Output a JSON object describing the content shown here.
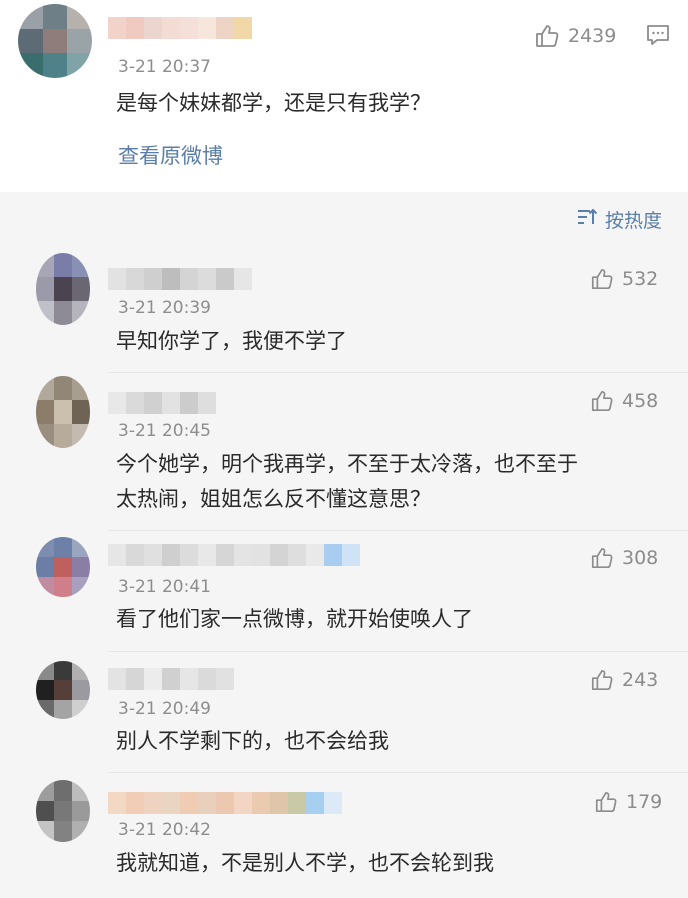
{
  "main_comment": {
    "avatar_colors": [
      "#9aa0a8",
      "#6f7f88",
      "#b7b1ad",
      "#5d6b76",
      "#8e7d7a",
      "#9aa3a8",
      "#3a6d6e",
      "#4e8288",
      "#7fa3a6"
    ],
    "name_colors": [
      "#f2d3c9",
      "#f0c9c0",
      "#ead6cf",
      "#f3dcd3",
      "#f4e0d8",
      "#f6e6dc",
      "#eed4c5",
      "#f0d8a8"
    ],
    "time": "3-21 20:37",
    "text": "是每个妹妹都学，还是只有我学？",
    "likes": "2439",
    "view_original": "查看原微博"
  },
  "sort": {
    "label": "按热度"
  },
  "replies": [
    {
      "avatar_colors": [
        "#a6a6b6",
        "#7a7da8",
        "#8890b4",
        "#9b9aa8",
        "#4b4350",
        "#6b6772",
        "#c0c0c8",
        "#8e8a96",
        "#b5b3bc"
      ],
      "name_colors": [
        "#e2e2e2",
        "#d8d8d8",
        "#cfcfcf",
        "#bdbdbd",
        "#d4d4d4",
        "#dcdcdc",
        "#cacaca",
        "#e6e6e6"
      ],
      "time": "3-21 20:39",
      "text": "早知你学了，我便不学了",
      "likes": "532"
    },
    {
      "avatar_colors": [
        "#b2a89c",
        "#928676",
        "#a89e90",
        "#8c7c6a",
        "#cbbfae",
        "#6e6354",
        "#9a8e80",
        "#b7ab9c",
        "#c4bbb0"
      ],
      "name_colors": [
        "#e8e8e8",
        "#dadada",
        "#d0d0d0",
        "#e2e2e2",
        "#cccccc",
        "#dedede"
      ],
      "time": "3-21 20:45",
      "text": [
        "今个她学，明个我再学，不至于太冷落，也不至于",
        "太热闹，姐姐怎么反不懂这意思？"
      ],
      "likes": "458"
    },
    {
      "avatar_colors": [
        "#7c8db0",
        "#6d80a8",
        "#9aa5c0",
        "#6d7ea6",
        "#c0605e",
        "#8a7ea4",
        "#c28ca0",
        "#d07e8a",
        "#a9a0c0"
      ],
      "name_colors": [
        "#e6e6e6",
        "#d9d9d9",
        "#e0e0e0",
        "#cfcfcf",
        "#dcdcdc",
        "#e8e8e8",
        "#d6d6d6",
        "#e4e4e4",
        "#e2e2e2",
        "#d4d4d4",
        "#dedede",
        "#e9e9e9",
        "#a9cdf0",
        "#cfe3f7"
      ],
      "time": "3-21 20:41",
      "text": "看了他们家一点微博，就开始使唤人了",
      "likes": "308"
    },
    {
      "avatar_colors": [
        "#8a8a8a",
        "#3a3a3a",
        "#b0b0b0",
        "#202020",
        "#553f38",
        "#9a9aa0",
        "#6a6a6a",
        "#a4a4a4",
        "#cfcfcf"
      ],
      "name_colors": [
        "#e3e3e3",
        "#d6d6d6",
        "#ececec",
        "#d0d0d0",
        "#e6e6e6",
        "#dadada",
        "#e1e1e1"
      ],
      "time": "3-21 20:49",
      "text": "别人不学剩下的，也不会给我",
      "likes": "243"
    },
    {
      "avatar_colors": [
        "#9d9d9d",
        "#6e6e6e",
        "#bcbcbc",
        "#4f4f4f",
        "#787878",
        "#9a9a9a",
        "#c4c4c4",
        "#828282",
        "#b0b0b0"
      ],
      "name_colors": [
        "#f3d9c4",
        "#f1cdb8",
        "#efd3c0",
        "#ead5c2",
        "#f0ccb2",
        "#e9d0bd",
        "#ecc8b0",
        "#f2d6c3",
        "#eacbb0",
        "#dfc6ab",
        "#c9c9a8",
        "#a7cff0",
        "#dce9f6"
      ],
      "time": "3-21 20:42",
      "text": "我就知道，不是别人不学，也不会轮到我",
      "likes": "179"
    }
  ]
}
